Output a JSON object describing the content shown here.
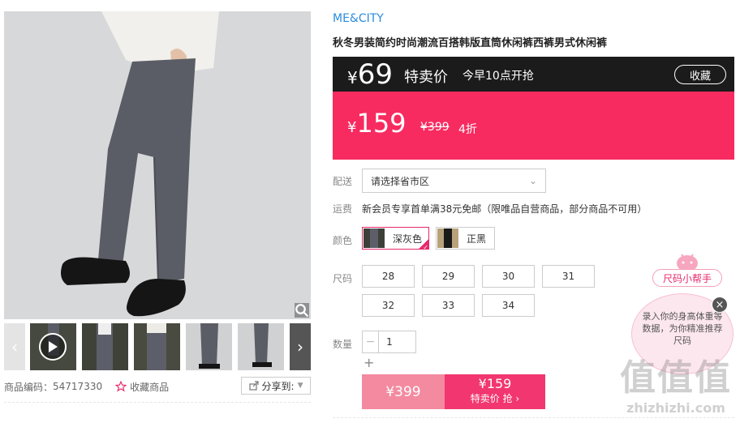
{
  "gallery": {
    "thumbnail_count": 6,
    "prev_icon": "chevron-left-icon",
    "next_icon": "chevron-right-icon",
    "zoom_icon": "magnifier-icon"
  },
  "meta": {
    "code_label": "商品编码：",
    "code_value": "54717330",
    "favorite_label": "收藏商品",
    "share_label": "分享到:"
  },
  "product": {
    "brand": "ME&CITY",
    "title": "秋冬男装简约时尚潮流百搭韩版直筒休闲裤西裤男式休闲裤"
  },
  "flash_sale": {
    "currency": "¥",
    "price": "69",
    "label": "特卖价",
    "start_time": "今早10点开抢",
    "collect_label": "收藏"
  },
  "price": {
    "currency": "¥",
    "current": "159",
    "original": "¥399",
    "discount": "4折"
  },
  "delivery": {
    "label": "配送",
    "placeholder": "请选择省市区"
  },
  "shipping": {
    "label": "运费",
    "text": "新会员专享首单满38元免邮（限唯品自营商品，部分商品不可用）"
  },
  "colors": {
    "label": "颜色",
    "options": [
      {
        "name": "深灰色",
        "selected": true
      },
      {
        "name": "正黑",
        "selected": false
      }
    ]
  },
  "sizes": {
    "label": "尺码",
    "options": [
      "28",
      "29",
      "30",
      "31",
      "32",
      "33",
      "34"
    ]
  },
  "quantity": {
    "label": "数量",
    "value": "1",
    "minus": "−",
    "plus": "+"
  },
  "buy": {
    "left_price": "¥399",
    "right_price": "¥159",
    "right_label": "特卖价 抢"
  },
  "helper": {
    "tag": "尺码小帮手",
    "bubble_text": "录入你的身高体重等数据，为你精准推荐尺码",
    "close": "×"
  },
  "watermark": {
    "text": "值值值",
    "url": "zhizhizhi.com"
  },
  "colors_theme": {
    "accent_pink": "#f72b60",
    "brand_blue": "#2c8be0",
    "flash_black": "#1b1b1b"
  }
}
